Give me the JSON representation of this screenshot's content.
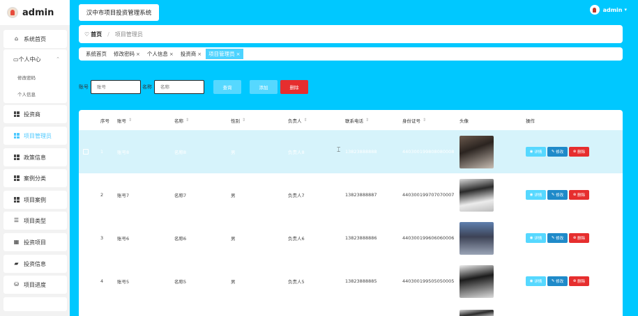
{
  "app": {
    "name": "admin",
    "system_title": "汉中市项目投资管理系统"
  },
  "user": {
    "name": "admin",
    "caret": "▾"
  },
  "sidebar": {
    "items": [
      {
        "label": "系统首页",
        "icon": "home-icon"
      },
      {
        "label": "个人中心",
        "icon": "user-center-icon",
        "expanded": true,
        "chevron": "⌃",
        "children": [
          {
            "label": "修改密码"
          },
          {
            "label": "个人信息"
          }
        ]
      },
      {
        "label": "投资商",
        "icon": "grid-icon"
      },
      {
        "label": "项目管理员",
        "icon": "grid-icon",
        "active": true
      },
      {
        "label": "政策信息",
        "icon": "grid-icon"
      },
      {
        "label": "案例分类",
        "icon": "grid-icon"
      },
      {
        "label": "项目案例",
        "icon": "grid-icon"
      },
      {
        "label": "项目类型",
        "icon": "list-icon"
      },
      {
        "label": "投资项目",
        "icon": "table-icon"
      },
      {
        "label": "投资信息",
        "icon": "wallet-icon"
      },
      {
        "label": "项目进度",
        "icon": "database-icon"
      }
    ]
  },
  "breadcrumb": {
    "home": "首页",
    "separator": "/",
    "current": "项目管理员"
  },
  "tags": [
    {
      "label": "系统首页",
      "closable": false
    },
    {
      "label": "修改密码",
      "closable": true
    },
    {
      "label": "个人信息",
      "closable": true
    },
    {
      "label": "投资商",
      "closable": true
    },
    {
      "label": "项目管理员",
      "closable": true,
      "active": true
    }
  ],
  "tag_close": "×",
  "search": {
    "account_label": "账号",
    "account_placeholder": "账号",
    "name_label": "名称",
    "name_placeholder": "名称",
    "query_label": "查询",
    "add_label": "添加",
    "delete_label": "删除"
  },
  "colors": {
    "primary": "#00c8ff",
    "accent": "#56d8ff",
    "edit": "#1f8ac9",
    "danger": "#e62e2e",
    "selected_row": "#d6f3fb"
  },
  "table": {
    "headers": [
      "序号",
      "账号",
      "名称",
      "性别",
      "负责人",
      "联系电话",
      "身份证号",
      "头像",
      "操作"
    ],
    "sort_icon": "⇕",
    "actions": {
      "view": "详情",
      "edit": "修改",
      "delete": "删除"
    },
    "rows": [
      {
        "index": "1",
        "account": "账号8",
        "name": "名称8",
        "gender": "男",
        "manager": "负责人8",
        "phone": "13823888888",
        "id_no": "440300199808080008",
        "selected": true
      },
      {
        "index": "2",
        "account": "账号7",
        "name": "名称7",
        "gender": "男",
        "manager": "负责人7",
        "phone": "13823888887",
        "id_no": "440300199707070007"
      },
      {
        "index": "3",
        "account": "账号6",
        "name": "名称6",
        "gender": "男",
        "manager": "负责人6",
        "phone": "13823888886",
        "id_no": "440300199606060006"
      },
      {
        "index": "4",
        "account": "账号5",
        "name": "名称5",
        "gender": "男",
        "manager": "负责人5",
        "phone": "13823888885",
        "id_no": "440300199505050005"
      }
    ]
  }
}
